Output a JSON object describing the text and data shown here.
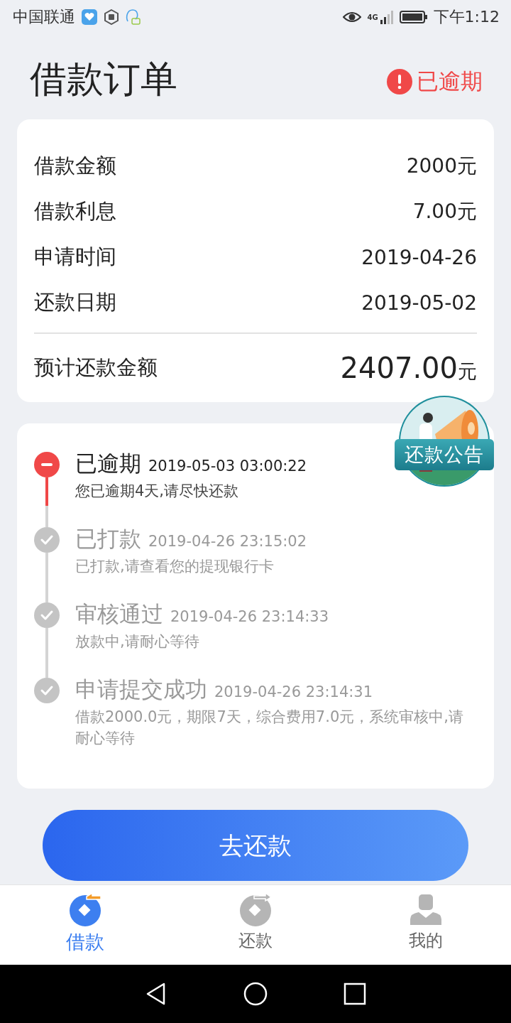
{
  "status_bar": {
    "carrier": "中国联通",
    "network": "4G",
    "time": "下午1:12"
  },
  "header": {
    "title": "借款订单",
    "status": "已逾期"
  },
  "summary": {
    "rows": [
      {
        "label": "借款金额",
        "value": "2000元"
      },
      {
        "label": "借款利息",
        "value": "7.00元"
      },
      {
        "label": "申请时间",
        "value": "2019-04-26"
      },
      {
        "label": "还款日期",
        "value": "2019-05-02"
      }
    ],
    "total": {
      "label": "预计还款金额",
      "amount": "2407.00",
      "unit": "元"
    }
  },
  "announcement": {
    "label": "还款公告"
  },
  "timeline": [
    {
      "kind": "overdue",
      "title": "已逾期",
      "time": "2019-05-03 03:00:22",
      "desc": "您已逾期4天,请尽快还款"
    },
    {
      "kind": "done",
      "title": "已打款",
      "time": "2019-04-26 23:15:02",
      "desc": "已打款,请查看您的提现银行卡"
    },
    {
      "kind": "done",
      "title": "审核通过",
      "time": "2019-04-26 23:14:33",
      "desc": "放款中,请耐心等待"
    },
    {
      "kind": "done",
      "title": "申请提交成功",
      "time": "2019-04-26 23:14:31",
      "desc": "借款2000.0元，期限7天，综合费用7.0元，系统审核中,请耐心等待"
    }
  ],
  "action_button": {
    "label": "去还款"
  },
  "tabs": [
    {
      "label": "借款",
      "kind": "borrow",
      "selected": true
    },
    {
      "label": "还款",
      "kind": "repay",
      "selected": false
    },
    {
      "label": "我的",
      "kind": "me",
      "selected": false
    }
  ]
}
